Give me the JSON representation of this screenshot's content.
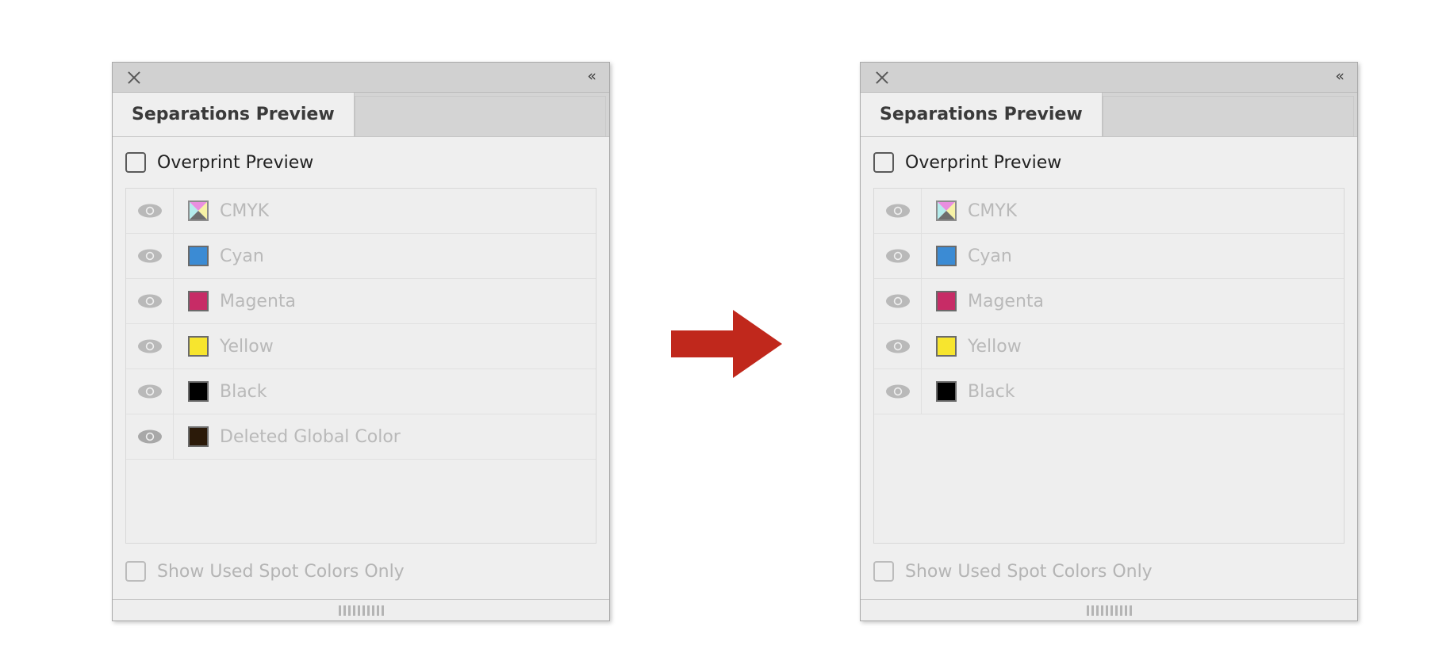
{
  "panels": [
    {
      "id": "before",
      "titlebar": {
        "close_icon": "close-icon",
        "collapse_icon": "double-chevron-left-icon",
        "collapse_glyph": "«"
      },
      "tab": {
        "label": "Separations Preview",
        "active": true
      },
      "overprint": {
        "label": "Overprint Preview",
        "checked": false,
        "enabled": true
      },
      "separations": [
        {
          "name": "CMYK",
          "swatch": "cmyk",
          "visible": true,
          "icon": "eye-icon"
        },
        {
          "name": "Cyan",
          "swatch": "#3b8bd4",
          "visible": true,
          "icon": "eye-icon"
        },
        {
          "name": "Magenta",
          "swatch": "#c72c66",
          "visible": true,
          "icon": "eye-icon"
        },
        {
          "name": "Yellow",
          "swatch": "#f7e52e",
          "visible": true,
          "icon": "eye-icon"
        },
        {
          "name": "Black",
          "swatch": "#000000",
          "visible": true,
          "icon": "eye-icon"
        },
        {
          "name": "Deleted Global Color",
          "swatch": "#2b1a09",
          "visible": true,
          "icon": "eye-icon"
        }
      ],
      "spot_only": {
        "label": "Show Used Spot Colors Only",
        "checked": false,
        "enabled": false
      }
    },
    {
      "id": "after",
      "titlebar": {
        "close_icon": "close-icon",
        "collapse_icon": "double-chevron-left-icon",
        "collapse_glyph": "«"
      },
      "tab": {
        "label": "Separations Preview",
        "active": true
      },
      "overprint": {
        "label": "Overprint Preview",
        "checked": false,
        "enabled": true
      },
      "separations": [
        {
          "name": "CMYK",
          "swatch": "cmyk",
          "visible": true,
          "icon": "eye-icon"
        },
        {
          "name": "Cyan",
          "swatch": "#3b8bd4",
          "visible": true,
          "icon": "eye-icon"
        },
        {
          "name": "Magenta",
          "swatch": "#c72c66",
          "visible": true,
          "icon": "eye-icon"
        },
        {
          "name": "Yellow",
          "swatch": "#f7e52e",
          "visible": true,
          "icon": "eye-icon"
        },
        {
          "name": "Black",
          "swatch": "#000000",
          "visible": true,
          "icon": "eye-icon"
        }
      ],
      "spot_only": {
        "label": "Show Used Spot Colors Only",
        "checked": false,
        "enabled": false
      }
    }
  ],
  "arrow": {
    "name": "right-arrow-icon",
    "color": "#c0281c",
    "direction": "right"
  },
  "cmyk_swatch": {
    "top": "#e98fe0",
    "left": "#b4ecec",
    "right": "#f7f2a6",
    "bottom": "#6e6e6e"
  },
  "colors": {
    "panel_background": "#efefef",
    "titlebar": "#d1d1d1",
    "tabstrip": "#d4d4d4",
    "separation_text": "#b9b9b9",
    "label_text": "#222222",
    "disabled_text": "#b4b4b4"
  }
}
